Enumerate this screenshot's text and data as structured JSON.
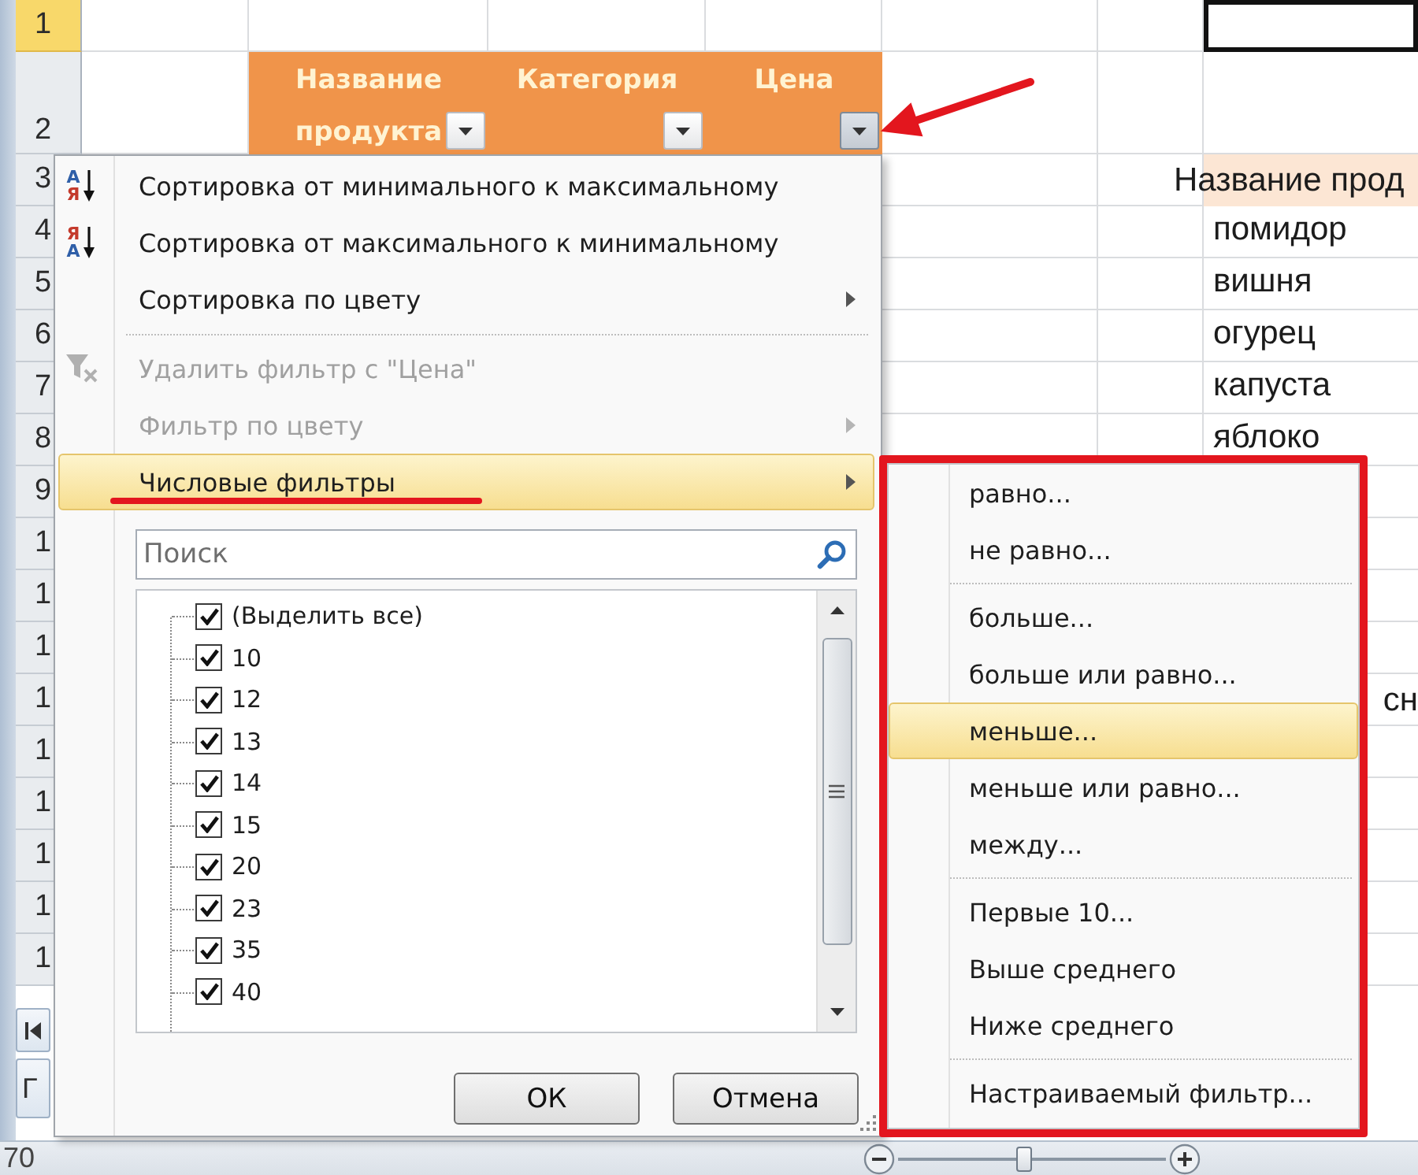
{
  "sheet": {
    "row_headers": [
      {
        "label": "1",
        "selected": true
      },
      {
        "label": "2",
        "selected": false
      },
      {
        "label": "3",
        "selected": false
      },
      {
        "label": "4",
        "selected": false
      },
      {
        "label": "5",
        "selected": false
      },
      {
        "label": "6",
        "selected": false
      },
      {
        "label": "7",
        "selected": false
      },
      {
        "label": "8",
        "selected": false
      },
      {
        "label": "9",
        "selected": false
      },
      {
        "label": "1",
        "selected": false
      },
      {
        "label": "1",
        "selected": false
      },
      {
        "label": "1",
        "selected": false
      },
      {
        "label": "1",
        "selected": false
      },
      {
        "label": "1",
        "selected": false
      },
      {
        "label": "1",
        "selected": false
      },
      {
        "label": "1",
        "selected": false
      },
      {
        "label": "1",
        "selected": false
      },
      {
        "label": "1",
        "selected": false
      }
    ],
    "table_headers": [
      {
        "label": "Название продукта",
        "filter_open": false
      },
      {
        "label": "Категория",
        "filter_open": false
      },
      {
        "label": "Цена",
        "filter_open": true
      }
    ],
    "side_table": {
      "heading": "Название прод",
      "items": [
        "помидор",
        "вишня",
        "огурец",
        "капуста",
        "яблоко"
      ]
    },
    "cut_text": "сн"
  },
  "filter_menu": {
    "items": [
      {
        "kind": "ascending",
        "icon_letters": [
          "А",
          "Я"
        ],
        "label": "Сортировка от минимального к максимальному",
        "disabled": false,
        "selected": false,
        "submenu": false
      },
      {
        "kind": "descending",
        "icon_letters": [
          "Я",
          "А"
        ],
        "label": "Сортировка от максимального к минимальному",
        "disabled": false,
        "selected": false,
        "submenu": false
      },
      {
        "kind": "plain",
        "label": "Сортировка по цвету",
        "disabled": false,
        "selected": false,
        "submenu": true
      },
      {
        "kind": "separator"
      },
      {
        "kind": "clear",
        "label": "Удалить фильтр с \"Цена\"",
        "disabled": true,
        "selected": false,
        "submenu": false
      },
      {
        "kind": "plain",
        "label": "Фильтр по цвету",
        "disabled": true,
        "selected": false,
        "submenu": true
      },
      {
        "kind": "plain",
        "label": "Числовые фильтры",
        "disabled": false,
        "selected": true,
        "submenu": true
      }
    ],
    "search": {
      "placeholder": "Поиск"
    },
    "values": [
      {
        "label": "(Выделить все)",
        "checked": true
      },
      {
        "label": "10",
        "checked": true
      },
      {
        "label": "12",
        "checked": true
      },
      {
        "label": "13",
        "checked": true
      },
      {
        "label": "14",
        "checked": true
      },
      {
        "label": "15",
        "checked": true
      },
      {
        "label": "20",
        "checked": true
      },
      {
        "label": "23",
        "checked": true
      },
      {
        "label": "35",
        "checked": true
      },
      {
        "label": "40",
        "checked": true
      }
    ],
    "buttons": [
      {
        "label": "ОК"
      },
      {
        "label": "Отмена"
      }
    ]
  },
  "annotations": [
    {
      "kind": "arrow"
    },
    {
      "kind": "underline"
    },
    {
      "kind": "frame"
    }
  ],
  "number_filters_menu": {
    "items": [
      {
        "kind": "item",
        "label": "равно...",
        "selected": false
      },
      {
        "kind": "item",
        "label": "не равно...",
        "selected": false
      },
      {
        "kind": "separator"
      },
      {
        "kind": "item",
        "label": "больше...",
        "selected": false
      },
      {
        "kind": "item",
        "label": "больше или равно...",
        "selected": false
      },
      {
        "kind": "item",
        "label": "меньше...",
        "selected": true
      },
      {
        "kind": "item",
        "label": "меньше или равно...",
        "selected": false
      },
      {
        "kind": "item",
        "label": "между...",
        "selected": false
      },
      {
        "kind": "separator"
      },
      {
        "kind": "item",
        "label": "Первые 10...",
        "selected": false
      },
      {
        "kind": "item",
        "label": "Выше среднего",
        "selected": false
      },
      {
        "kind": "item",
        "label": "Ниже среднего",
        "selected": false
      },
      {
        "kind": "separator"
      },
      {
        "kind": "item",
        "label": "Настраиваемый фильтр...",
        "selected": false
      }
    ]
  },
  "sheet_bar": {
    "tab": "Г"
  },
  "status_bar": {
    "text": "70",
    "zoom_slider": {
      "level": 0.47
    }
  }
}
